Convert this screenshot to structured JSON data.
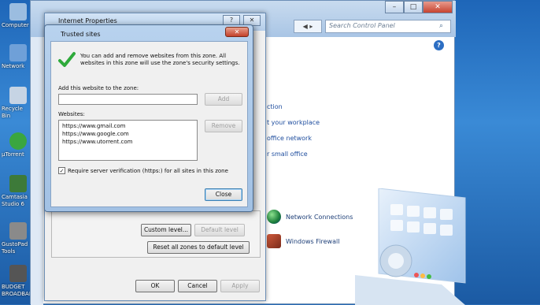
{
  "desktop": {
    "icons": [
      {
        "label": "Computer",
        "color": "#9bbde0"
      },
      {
        "label": "Network",
        "color": "#6fa0d8"
      },
      {
        "label": "Recycle Bin",
        "color": "#c6d4e4"
      },
      {
        "label": "µTorrent",
        "color": "#3aa640"
      },
      {
        "label": "Camtasia Studio 6",
        "color": "#3d7a39"
      },
      {
        "label": "GustoPad Tools",
        "color": "#8a8a8a"
      },
      {
        "label": "BUDGET BROADBAND",
        "color": "#555555"
      }
    ]
  },
  "control_panel": {
    "search_placeholder": "Search Control Panel",
    "nav": "◀ ▸",
    "links": [
      "ction",
      "t your workplace",
      "office network",
      "r small office"
    ],
    "items": [
      "Network Connections",
      "Windows Firewall"
    ],
    "help": "?"
  },
  "internet_properties": {
    "title": "Internet Properties",
    "help_btn": "?",
    "close_btn": "✕",
    "custom_level": "Custom level...",
    "default_level": "Default level",
    "reset_all": "Reset all zones to default level",
    "ok": "OK",
    "cancel": "Cancel",
    "apply": "Apply"
  },
  "trusted_sites": {
    "title": "Trusted sites",
    "close": "✕",
    "description": "You can add and remove websites from this zone. All websites in this zone will use the zone's security settings.",
    "add_label": "Add this website to the zone:",
    "add_value": "",
    "add_btn": "Add",
    "websites_label": "Websites:",
    "websites": [
      "https://www.gmail.com",
      "https://www.google.com",
      "https://www.utorrent.com"
    ],
    "remove_btn": "Remove",
    "verify_label": "Require server verification (https:) for all sites in this zone",
    "verify_checked": "✓",
    "close_btn": "Close"
  },
  "colors": {
    "accent": "#1e4d9e",
    "check": "#2eaa3b"
  }
}
